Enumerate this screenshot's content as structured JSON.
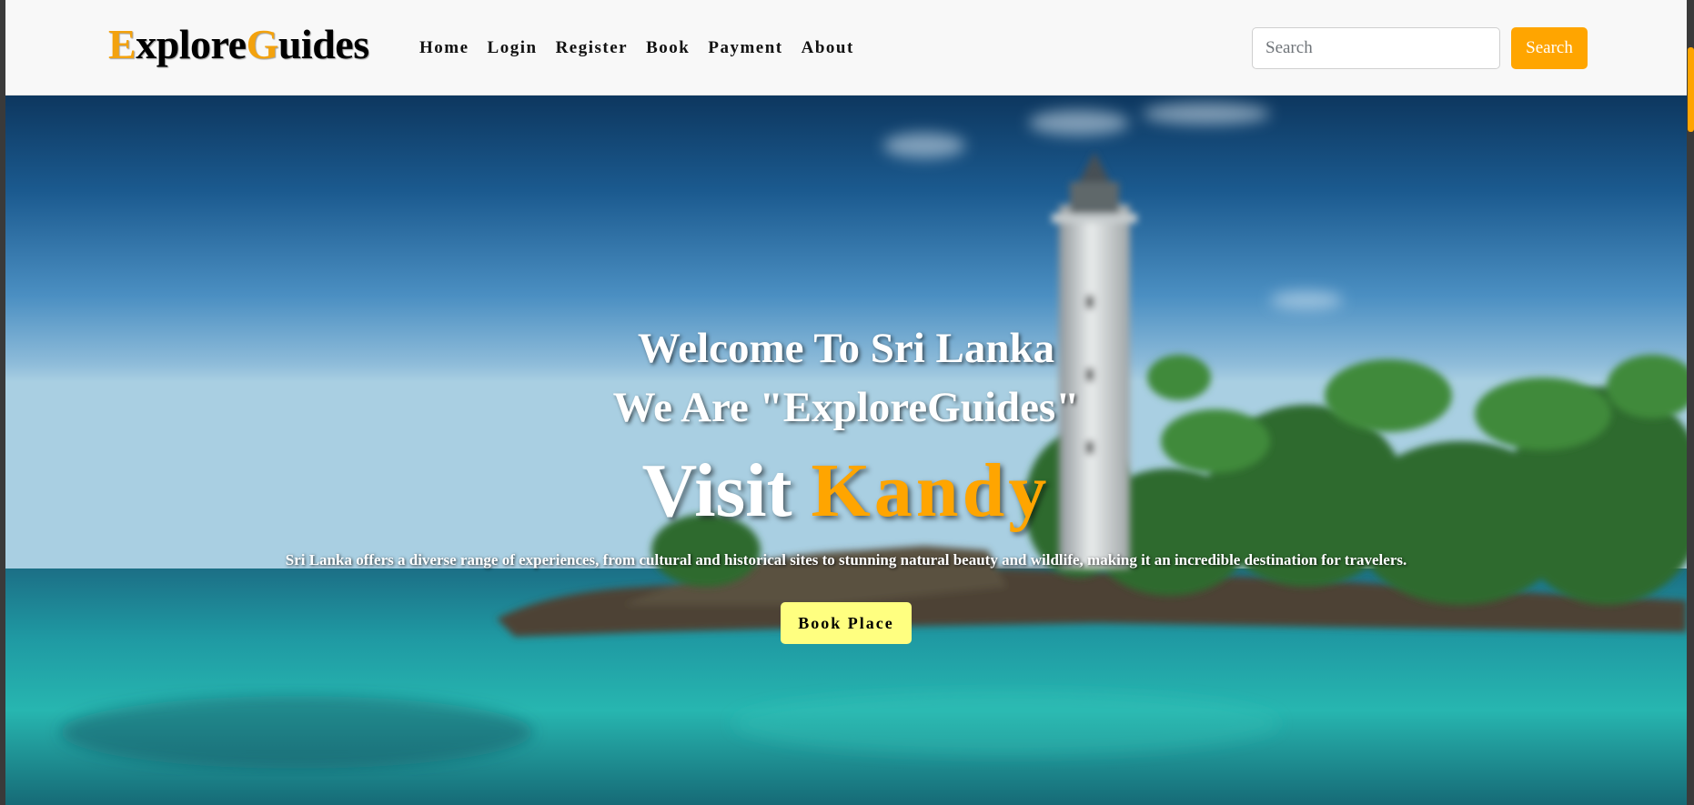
{
  "brand": {
    "first_letter": "E",
    "part1": "xplore",
    "second_letter": "G",
    "part2": "uides",
    "accent_color": "#f3a20e"
  },
  "nav": {
    "items": [
      {
        "label": "Home"
      },
      {
        "label": "Login"
      },
      {
        "label": "Register"
      },
      {
        "label": "Book"
      },
      {
        "label": "Payment"
      },
      {
        "label": "About"
      }
    ]
  },
  "search": {
    "placeholder": "Search",
    "value": "",
    "button_label": "Search",
    "button_color": "#ffa500"
  },
  "hero": {
    "line1": "Welcome To Sri Lanka",
    "line2": "We Are \"ExploreGuides\"",
    "visit_prefix": "Visit",
    "visit_place": "Kandy",
    "description": "Sri Lanka offers a diverse range of experiences, from cultural and historical sites to stunning natural beauty and wildlife, making it an incredible destination for travelers.",
    "button_label": "Book Place",
    "button_color": "#ffff80",
    "background_image": "lighthouse-beach-photo"
  }
}
